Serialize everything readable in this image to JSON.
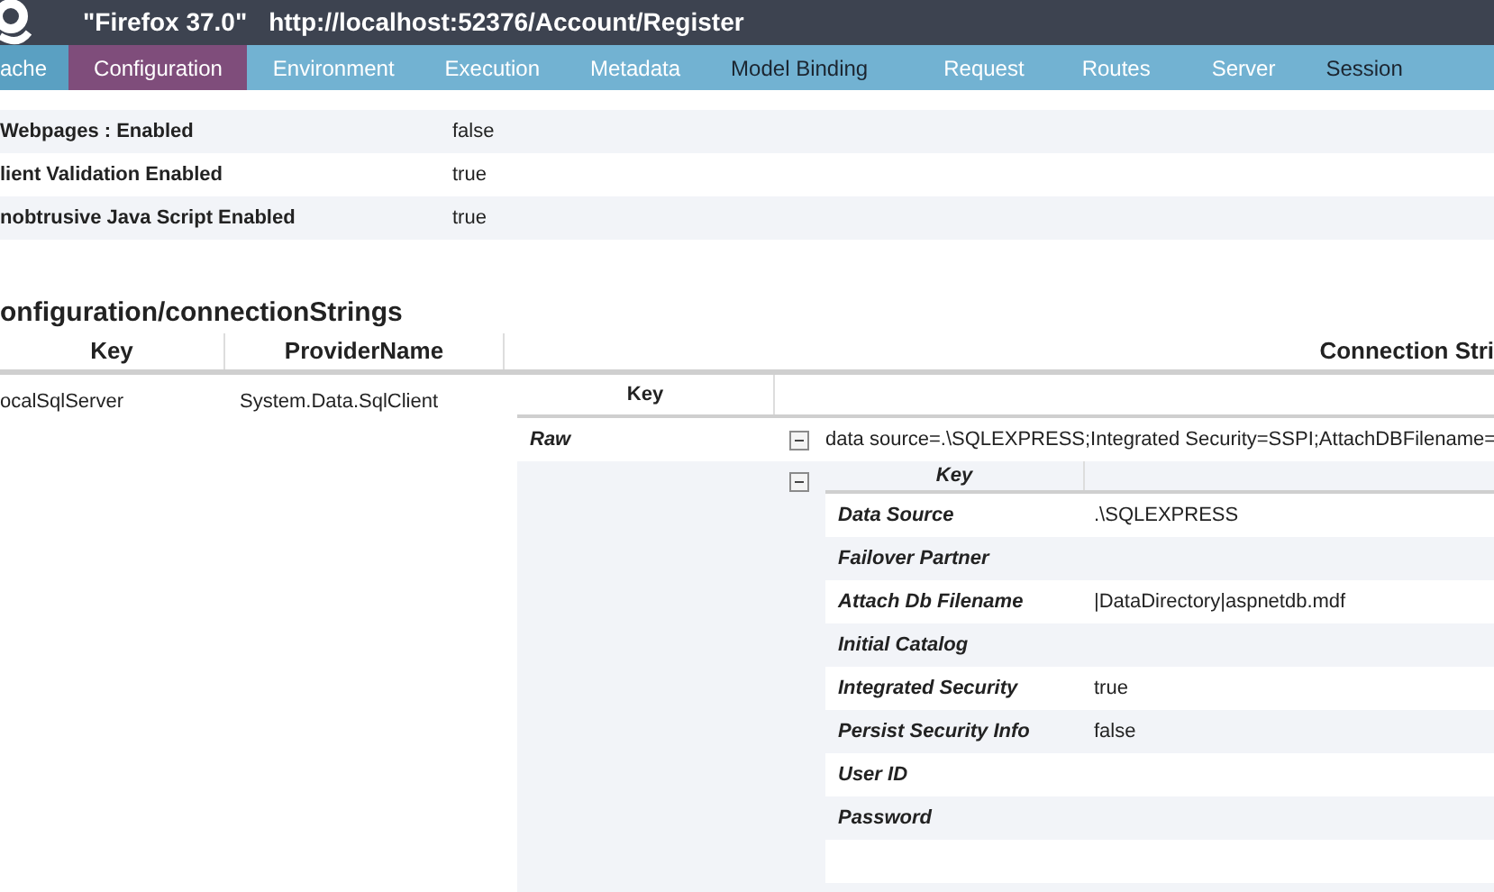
{
  "title_bar": {
    "browser": "\"Firefox 37.0\"",
    "url": "http://localhost:52376/Account/Register"
  },
  "tabs": [
    {
      "label": "ache",
      "selected": false,
      "emphasized": false,
      "dark": true
    },
    {
      "label": "Configuration",
      "selected": true,
      "emphasized": false,
      "dark": false
    },
    {
      "label": "Environment",
      "selected": false,
      "emphasized": false,
      "dark": false
    },
    {
      "label": "Execution",
      "selected": false,
      "emphasized": false,
      "dark": false
    },
    {
      "label": "Metadata",
      "selected": false,
      "emphasized": false,
      "dark": false
    },
    {
      "label": "Model Binding",
      "selected": false,
      "emphasized": true,
      "dark": false
    },
    {
      "label": "Request",
      "selected": false,
      "emphasized": false,
      "dark": false
    },
    {
      "label": "Routes",
      "selected": false,
      "emphasized": false,
      "dark": false
    },
    {
      "label": "Server",
      "selected": false,
      "emphasized": false,
      "dark": false
    },
    {
      "label": "Session",
      "selected": false,
      "emphasized": true,
      "dark": false
    }
  ],
  "settings": [
    {
      "key": "Webpages : Enabled",
      "value": "false"
    },
    {
      "key": "lient Validation Enabled",
      "value": "true"
    },
    {
      "key": "nobtrusive Java Script Enabled",
      "value": "true"
    }
  ],
  "section_title": "onfiguration/connectionStrings",
  "connection_table": {
    "columns": [
      "Key",
      "ProviderName",
      "Connection Stri"
    ],
    "row": {
      "key": "ocalSqlServer",
      "provider": "System.Data.SqlClient",
      "nested": {
        "columns": [
          "Key"
        ],
        "raw": {
          "key": "Raw",
          "expanded": true,
          "value": "data source=.\\SQLEXPRESS;Integrated Security=SSPI;AttachDBFilename="
        },
        "parsed": {
          "expanded": true,
          "columns": [
            "Key"
          ],
          "rows": [
            {
              "key": "Data Source",
              "value": ".\\SQLEXPRESS"
            },
            {
              "key": "Failover Partner"
            },
            {
              "key": "Attach Db Filename",
              "value": "|DataDirectory|aspnetdb.mdf"
            },
            {
              "key": "Initial Catalog"
            },
            {
              "key": "Integrated Security",
              "value": "true"
            },
            {
              "key": "Persist Security Info",
              "value": "false"
            },
            {
              "key": "User ID"
            },
            {
              "key": "Password"
            }
          ]
        }
      }
    }
  }
}
